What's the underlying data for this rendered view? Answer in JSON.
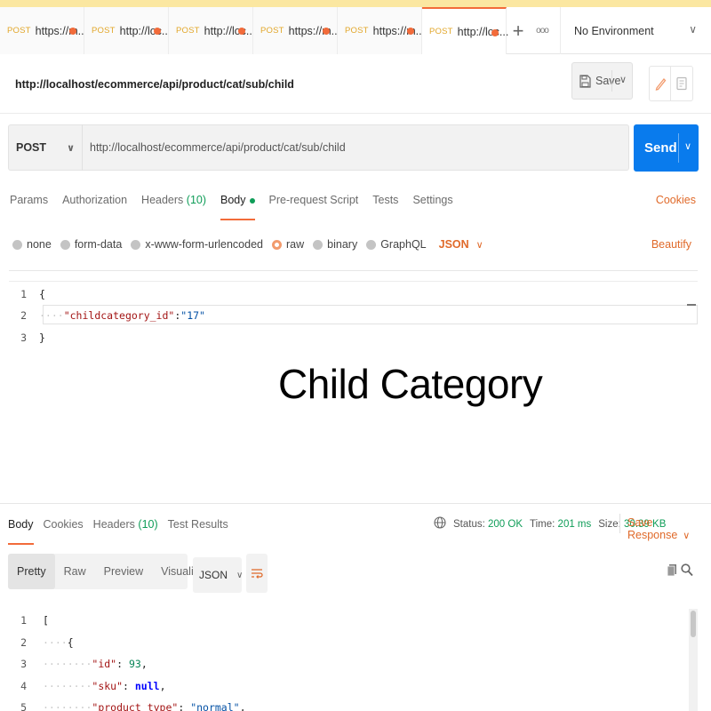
{
  "tabs": [
    {
      "method": "POST",
      "url": "https://m...",
      "active": false
    },
    {
      "method": "POST",
      "url": "http://loc...",
      "active": false
    },
    {
      "method": "POST",
      "url": "http://loc...",
      "active": false
    },
    {
      "method": "POST",
      "url": "https://m...",
      "active": false
    },
    {
      "method": "POST",
      "url": "https://m...",
      "active": false
    },
    {
      "method": "POST",
      "url": "http://loc...",
      "active": true
    }
  ],
  "environment": {
    "label": "No Environment"
  },
  "request": {
    "title": "http://localhost/ecommerce/api/product/cat/sub/child",
    "save_label": "Save",
    "method": "POST",
    "url": "http://localhost/ecommerce/api/product/cat/sub/child",
    "send_label": "Send"
  },
  "request_tabs": {
    "params": "Params",
    "authorization": "Authorization",
    "headers": "Headers",
    "headers_count": "(10)",
    "body": "Body",
    "prerequest": "Pre-request Script",
    "tests": "Tests",
    "settings": "Settings",
    "cookies": "Cookies"
  },
  "body_types": {
    "none": "none",
    "form_data": "form-data",
    "urlencoded": "x-www-form-urlencoded",
    "raw": "raw",
    "binary": "binary",
    "graphql": "GraphQL",
    "format": "JSON",
    "beautify": "Beautify"
  },
  "request_body": {
    "line1": "{",
    "key": "\"childcategory_id\"",
    "colon": ":",
    "value": "\"17\"",
    "line3": "}",
    "line_numbers": [
      "1",
      "2",
      "3"
    ]
  },
  "overlay_text": "Child Category",
  "response_tabs": {
    "body": "Body",
    "cookies": "Cookies",
    "headers": "Headers",
    "headers_count": "(10)",
    "test_results": "Test Results"
  },
  "response_status": {
    "status_label": "Status:",
    "status_value": "200 OK",
    "time_label": "Time:",
    "time_value": "201 ms",
    "size_label": "Size:",
    "size_value": "30.39 KB",
    "save_response": "Save Response"
  },
  "view_tabs": {
    "pretty": "Pretty",
    "raw": "Raw",
    "preview": "Preview",
    "visualize": "Visualize",
    "format": "JSON"
  },
  "response_body": {
    "line_numbers": [
      "1",
      "2",
      "3",
      "4",
      "5"
    ],
    "l1": "[",
    "l2": "{",
    "l3_key": "\"id\"",
    "l3_val": "93",
    "l4_key": "\"sku\"",
    "l4_val": "null",
    "l5_key": "\"product_type\"",
    "l5_val": "\"normal\""
  }
}
